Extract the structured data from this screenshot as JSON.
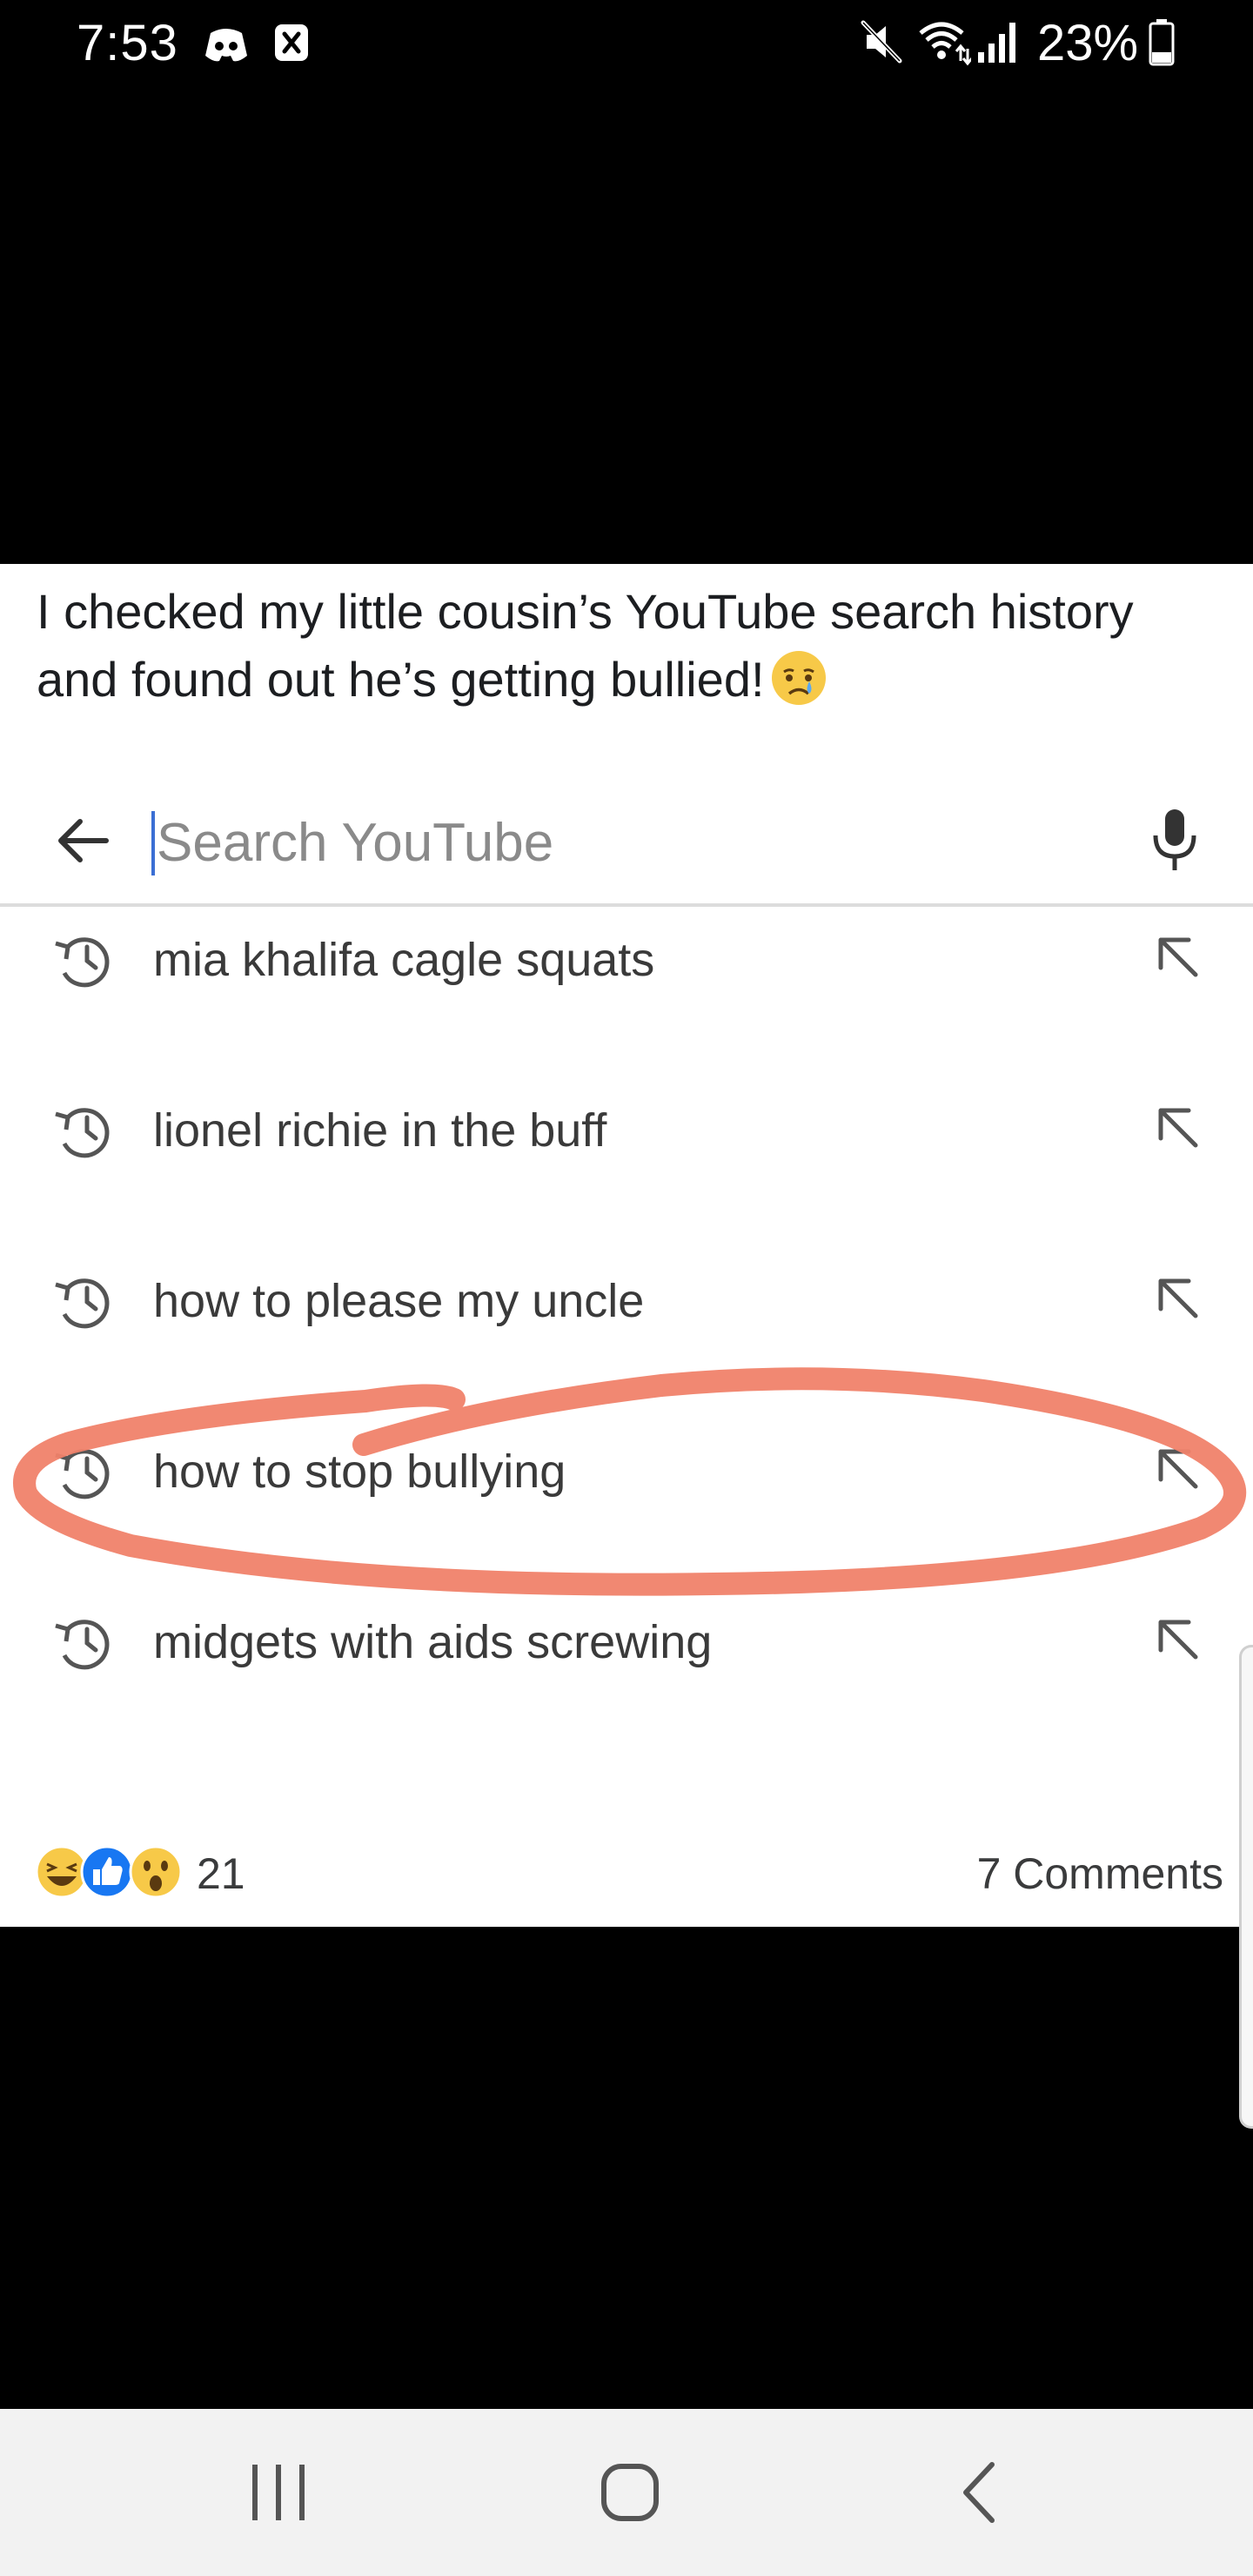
{
  "status_bar": {
    "time": "7:53",
    "battery": "23%",
    "icons": [
      "discord-icon",
      "notification-x-icon",
      "mute-icon",
      "wifi-icon",
      "signal-icon",
      "battery-icon"
    ]
  },
  "post": {
    "caption": "I checked my little cousin’s YouTube search history and found out he’s getting bullied!",
    "caption_emoji": "crying-face-emoji",
    "youtube": {
      "search": {
        "placeholder": "Search YouTube",
        "value": ""
      },
      "history": [
        {
          "label": "mia khalifa cagle squats",
          "circled": false
        },
        {
          "label": "lionel richie in the buff",
          "circled": false
        },
        {
          "label": "how to please my uncle",
          "circled": false
        },
        {
          "label": "how to stop bullying",
          "circled": true
        },
        {
          "label": "midgets with aids screwing",
          "circled": false
        }
      ],
      "annotation_color": "#f0826a"
    },
    "reactions": {
      "icons": [
        "haha-icon",
        "like-icon",
        "wow-icon"
      ],
      "count": "21",
      "comments": "7 Comments"
    }
  },
  "nav_bar": {
    "buttons": [
      "recents-button",
      "home-button",
      "back-button"
    ]
  },
  "colors": {
    "background": "#000000",
    "card": "#ffffff",
    "like_blue": "#1877f2",
    "reaction_yellow": "#f7c948",
    "nav_bar": "#f2f2f2"
  }
}
